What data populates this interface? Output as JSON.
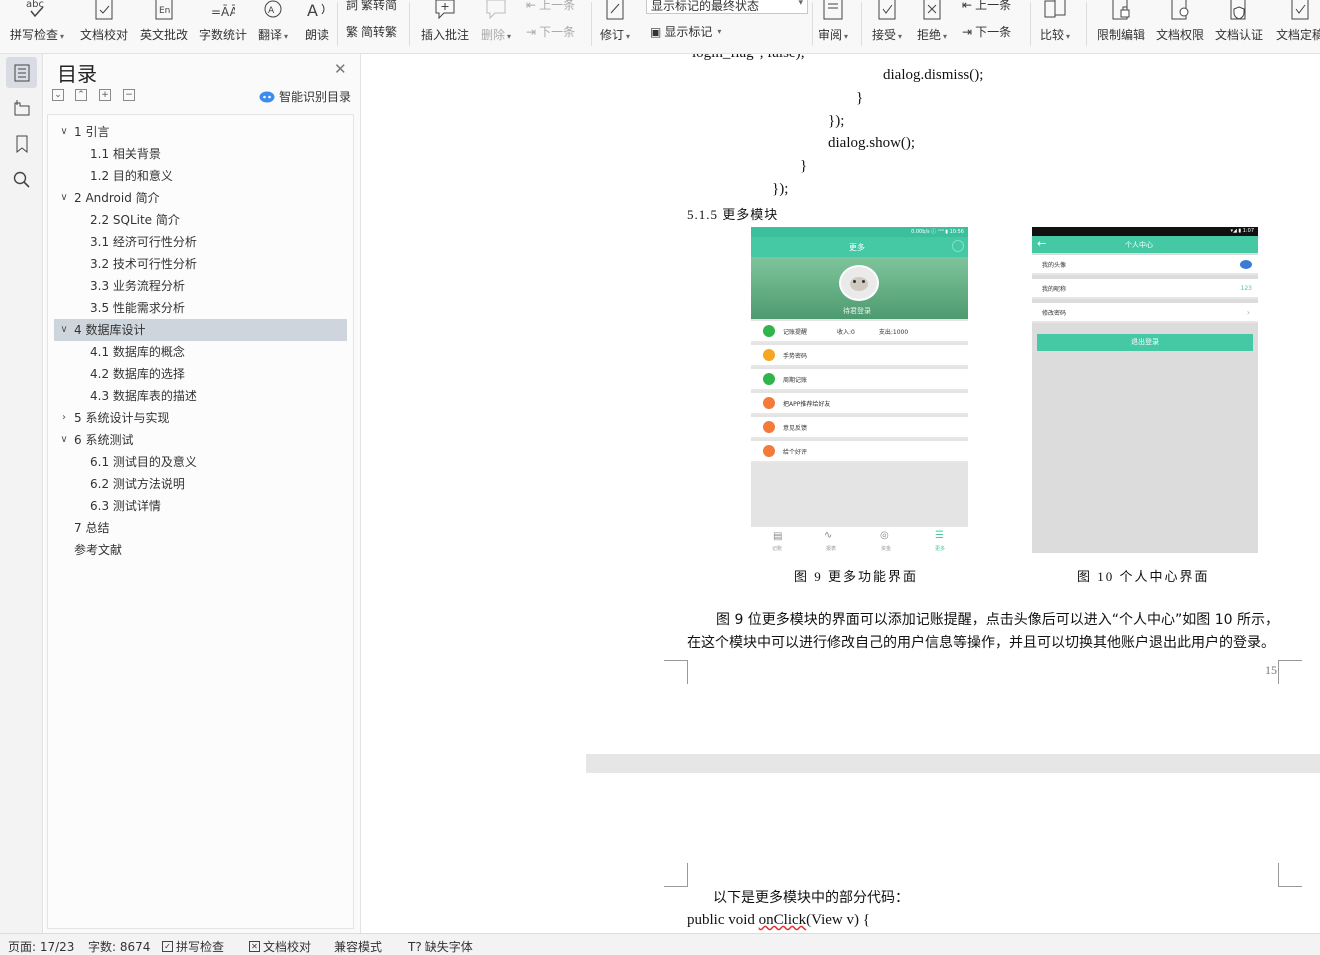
{
  "ribbon": {
    "spell_check": "拼写检查",
    "doc_proof": "文档校对",
    "en_review": "英文批改",
    "word_count": "字数统计",
    "translate": "翻译",
    "read_aloud": "朗读",
    "trad_to_simp": "繁转简",
    "simp_to_trad": "简转繁",
    "insert_comment": "插入批注",
    "delete": "删除",
    "prev_comment": "上一条",
    "next_comment": "下一条",
    "revise": "修订",
    "markup_state": "显示标记的最终状态",
    "show_markup": "显示标记",
    "review_pane": "审阅",
    "accept": "接受",
    "reject": "拒绝",
    "prev_change": "上一条",
    "next_change": "下一条",
    "compare": "比较",
    "restrict_edit": "限制编辑",
    "doc_permission": "文档权限",
    "doc_certify": "文档认证",
    "doc_finalize": "文档定稿"
  },
  "toc": {
    "title": "目录",
    "smart_detect": "智能识别目录",
    "items": [
      {
        "label": "1 引言"
      },
      {
        "label": "1.1  相关背景"
      },
      {
        "label": "1.2  目的和意义"
      },
      {
        "label": "2 Android 简介"
      },
      {
        "label": "2.2 SQLite 简介"
      },
      {
        "label": "3.1 经济可行性分析"
      },
      {
        "label": "3.2 技术可行性分析"
      },
      {
        "label": "3.3 业务流程分析"
      },
      {
        "label": "3.5 性能需求分析"
      },
      {
        "label": "4  数据库设计"
      },
      {
        "label": "4.1  数据库的概念"
      },
      {
        "label": "4.2  数据库的选择"
      },
      {
        "label": "4.3  数据库表的描述"
      },
      {
        "label": "5 系统设计与实现"
      },
      {
        "label": "6 系统测试"
      },
      {
        "label": "6.1 测试目的及意义"
      },
      {
        "label": "6.2 测试方法说明"
      },
      {
        "label": "6.3 测试详情"
      },
      {
        "label": "7 总结"
      },
      {
        "label": "参考文献"
      }
    ]
  },
  "doc": {
    "code_lines": [
      "login_flag\", false);",
      "dialog.dismiss();",
      "}",
      "});",
      "dialog.show();",
      "}",
      "});"
    ],
    "section_heading": "5.1.5  更多模块",
    "fig9": {
      "caption": "图 9  更多功能界面",
      "header_title": "更多",
      "status_text": "0.00b/s ⓘ ᵛᵒˡˡ ▮ 10:56",
      "login_text": "待君登录",
      "row1_label": "记账提醒",
      "row1_income": "收入:0",
      "row1_expense": "支出:1000",
      "rows": [
        "手势密码",
        "周期记账",
        "把APP推荐给好友",
        "意见反馈",
        "给个好评"
      ],
      "tabs": [
        "记账",
        "报表",
        "资金",
        "更多"
      ]
    },
    "fig10": {
      "caption": "图 10  个人中心界面",
      "status_text": "▾◢ ▮ 1:07",
      "header_title": "个人中心",
      "row_avatar": "我的头像",
      "row_nickname": "我的昵称",
      "nickname_value": "123",
      "row_password": "修改密码",
      "logout": "退出登录"
    },
    "paragraph_line1": "图 9 位更多模块的界面可以添加记账提醒，点击头像后可以进入“个人中心”如图 10 所示，",
    "paragraph_line2": "在这个模块中可以进行修改自己的用户信息等操作，并且可以切换其他账户退出此用户的登录。",
    "page_number": "15",
    "next_intro": "以下是更多模块中的部分代码：",
    "next_code_prefix": "public void ",
    "next_code_method": "onClick",
    "next_code_suffix": "(View v) {"
  },
  "status": {
    "page": "页面: 17/23",
    "words": "字数: 8674",
    "spell": "拼写检查",
    "proof": "文档校对",
    "compat": "兼容模式",
    "missing_font": "缺失字体"
  },
  "colors": {
    "accent_green": "#40c4a4",
    "selected_toc": "#cfd5dc"
  }
}
